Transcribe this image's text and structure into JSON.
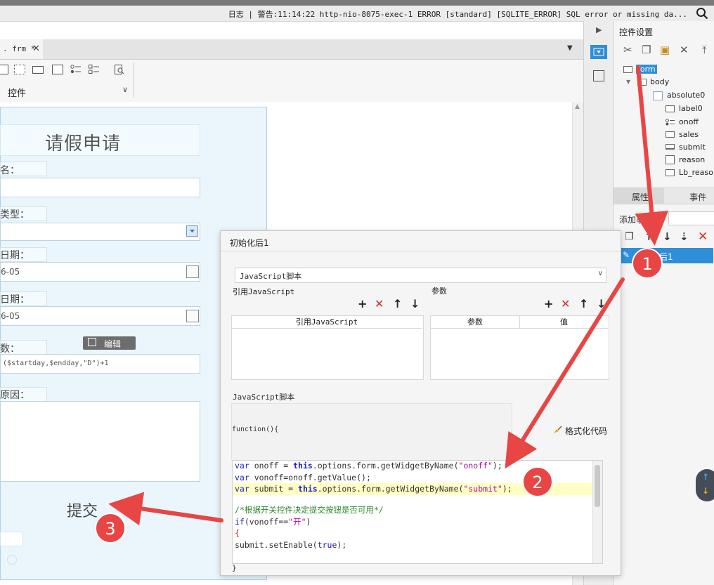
{
  "logbar": {
    "text": "日志 | 警告:11:14:22 http-nio-8075-exec-1 ERROR [standard] [SQLITE_ERROR] SQL error or missing da..."
  },
  "tab": {
    "label": ". frm *",
    "close": "✕"
  },
  "toolbar": {
    "controls_label": "控件"
  },
  "form": {
    "title": "请假申请",
    "name_label": "名：",
    "type_label": "类型：",
    "start_label": "日期：",
    "start_value": "6-05",
    "end_label": "日期：",
    "end_value": "6-05",
    "days_label": "数：",
    "days_formula": "($startday,$endday,\"D\")+1",
    "reason_label": "原因：",
    "edit_button": "编辑",
    "submit_label": "提交"
  },
  "right_panel": {
    "title": "控件设置",
    "tree": [
      {
        "label": "form",
        "icon": "form-icon",
        "selected": true
      },
      {
        "label": "body",
        "icon": "body-icon"
      },
      {
        "label": "absolute0",
        "icon": "absolute-icon"
      },
      {
        "label": "label0",
        "icon": "label-icon"
      },
      {
        "label": "onoff",
        "icon": "radio-icon"
      },
      {
        "label": "sales",
        "icon": "textbox-icon"
      },
      {
        "label": "submit",
        "icon": "button-icon"
      },
      {
        "label": "reason",
        "icon": "textarea-icon"
      },
      {
        "label": "Lb_reaso",
        "icon": "label-icon"
      }
    ],
    "tab_props": "属性",
    "tab_events": "事件",
    "add_event": "添加事件",
    "event_item": "化后1"
  },
  "dialog": {
    "title": "初始化后1",
    "select_value": "JavaScript脚本",
    "ref_js_header": "引用JavaScript",
    "params_header": "参数",
    "ref_js_col": "引用JavaScript",
    "param_col": "参数",
    "value_col": "值",
    "js_script_label": "JavaScript脚本",
    "function_open": "function(){",
    "format_button": "格式化代码",
    "function_close": "}"
  },
  "code": {
    "line1": {
      "kw": "var",
      "a": " onoff = ",
      "kw2": "this",
      "b": ".options.form.getWidgetByName(",
      "str": "\"onoff\"",
      "c": ");"
    },
    "line2": {
      "kw": "var",
      "a": " vonoff=onoff.getValue();"
    },
    "line3": {
      "kw": "var",
      "a": " submit = ",
      "kw2": "this",
      "b": ".options.form.getWidgetByName(",
      "str": "\"submit\"",
      "c": ");"
    },
    "line4": "/*根据开关控件决定提交按钮是否可用*/",
    "line5": {
      "kw": "if",
      "a": "(vonoff==",
      "str": "\"开\"",
      "c": ")"
    },
    "line6": "{",
    "line7": {
      "a": "submit.setEnable(",
      "kw": "true",
      "c": ");"
    }
  },
  "annotations": {
    "badge1": "1",
    "badge2": "2",
    "badge3": "3"
  },
  "colors": {
    "accent": "#2e8fd8",
    "arrow": "#e84545",
    "form_bg": "#eaf6fc"
  }
}
